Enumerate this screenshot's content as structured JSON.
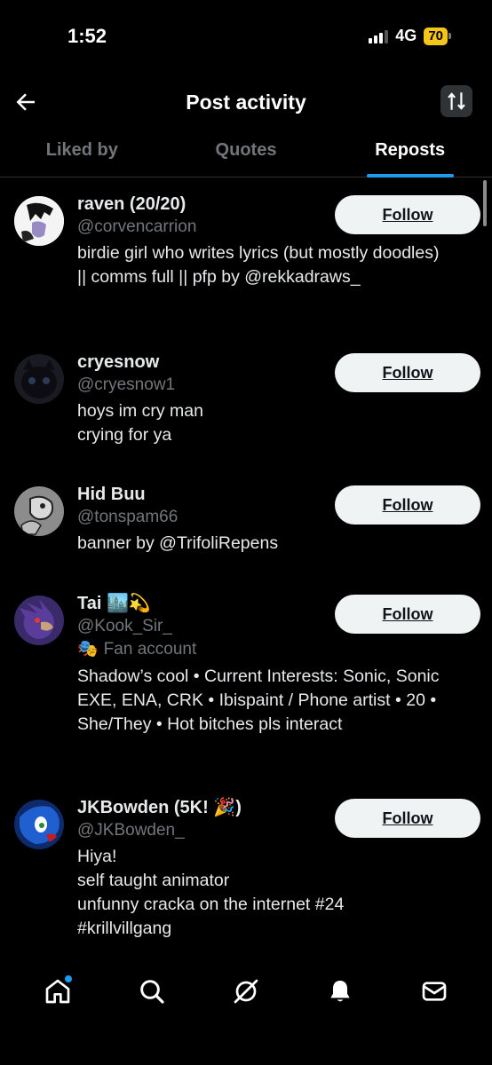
{
  "status_bar": {
    "time": "1:52",
    "network": "4G",
    "battery": "70"
  },
  "header": {
    "title": "Post activity"
  },
  "tabs": [
    {
      "label": "Liked by",
      "active": false
    },
    {
      "label": "Quotes",
      "active": false
    },
    {
      "label": "Reposts",
      "active": true
    }
  ],
  "users": [
    {
      "display_name": "raven (20/20)",
      "handle": "@corvencarrion",
      "bio": "birdie girl who writes lyrics (but mostly doodles) || comms full || pfp by @rekkadraws_",
      "follow_label": "Follow"
    },
    {
      "display_name": "cryesnow",
      "handle": "@cryesnow1",
      "bio": "hoys im cry man\ncrying for ya",
      "follow_label": "Follow"
    },
    {
      "display_name": "Hid Buu",
      "handle": "@tonspam66",
      "bio": "banner by @TrifoliRepens",
      "follow_label": "Follow"
    },
    {
      "display_name": "Tai 🏙️💫",
      "handle": "@Kook_Sir_",
      "fan_label": "Fan account",
      "bio": "Shadow’s cool • Current Interests: Sonic, Sonic EXE, ENA, CRK • Ibispaint / Phone artist • 20 • She/They • Hot bitches pls interact",
      "follow_label": "Follow"
    },
    {
      "display_name": "JKBowden (5K! 🎉)",
      "handle": "@JKBowden_",
      "bio": "Hiya!\nself taught animator\nunfunny cracka on the internet #24\n#krillvillgang",
      "follow_label": "Follow"
    }
  ],
  "bottom_nav": [
    {
      "icon": "home-icon",
      "has_badge": true
    },
    {
      "icon": "search-icon"
    },
    {
      "icon": "grok-icon"
    },
    {
      "icon": "bell-icon"
    },
    {
      "icon": "mail-icon"
    }
  ],
  "colors": {
    "accent": "#1d9bf0",
    "muted": "#71767b",
    "button_bg": "#eff3f4"
  }
}
